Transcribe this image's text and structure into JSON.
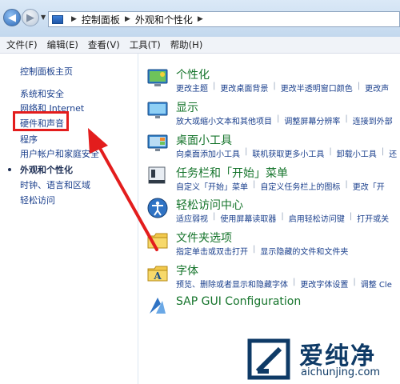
{
  "address": {
    "breadcrumbs": [
      "控制面板",
      "外观和个性化"
    ]
  },
  "menu": {
    "items": [
      "文件(F)",
      "编辑(E)",
      "查看(V)",
      "工具(T)",
      "帮助(H)"
    ]
  },
  "sidebar": {
    "items": [
      {
        "label": "控制面板主页"
      },
      {
        "label": "系统和安全"
      },
      {
        "label": "网络和 Internet"
      },
      {
        "label": "硬件和声音"
      },
      {
        "label": "程序"
      },
      {
        "label": "用户帐户和家庭安全"
      },
      {
        "label": "外观和个性化"
      },
      {
        "label": "时钟、语言和区域"
      },
      {
        "label": "轻松访问"
      }
    ],
    "current_index": 6,
    "highlighted_index": 3
  },
  "categories": [
    {
      "title": "个性化",
      "icon": "personalization-icon",
      "links": [
        "更改主题",
        "更改桌面背景",
        "更改半透明窗口颜色",
        "更改声"
      ]
    },
    {
      "title": "显示",
      "icon": "display-icon",
      "links": [
        "放大或缩小文本和其他项目",
        "调整屏幕分辨率",
        "连接到外部"
      ]
    },
    {
      "title": "桌面小工具",
      "icon": "gadgets-icon",
      "links": [
        "向桌面添加小工具",
        "联机获取更多小工具",
        "卸载小工具",
        "还"
      ]
    },
    {
      "title": "任务栏和「开始」菜单",
      "icon": "taskbar-icon",
      "links": [
        "自定义「开始」菜单",
        "自定义任务栏上的图标",
        "更改「开"
      ]
    },
    {
      "title": "轻松访问中心",
      "icon": "ease-of-access-icon",
      "links": [
        "适应弱视",
        "使用屏幕读取器",
        "启用轻松访问键",
        "打开或关"
      ]
    },
    {
      "title": "文件夹选项",
      "icon": "folder-options-icon",
      "links": [
        "指定单击或双击打开",
        "显示隐藏的文件和文件夹"
      ]
    },
    {
      "title": "字体",
      "icon": "fonts-icon",
      "links": [
        "预览、删除或者显示和隐藏字体",
        "更改字体设置",
        "调整 Cle"
      ]
    },
    {
      "title": "SAP GUI Configuration",
      "icon": "sap-gui-icon",
      "links": []
    }
  ],
  "watermark": {
    "main": "爱纯净",
    "sub": "aichunjing.com"
  },
  "colors": {
    "link": "#1a3f8c",
    "category_title": "#15742b",
    "annotation": "#e31d1d"
  }
}
